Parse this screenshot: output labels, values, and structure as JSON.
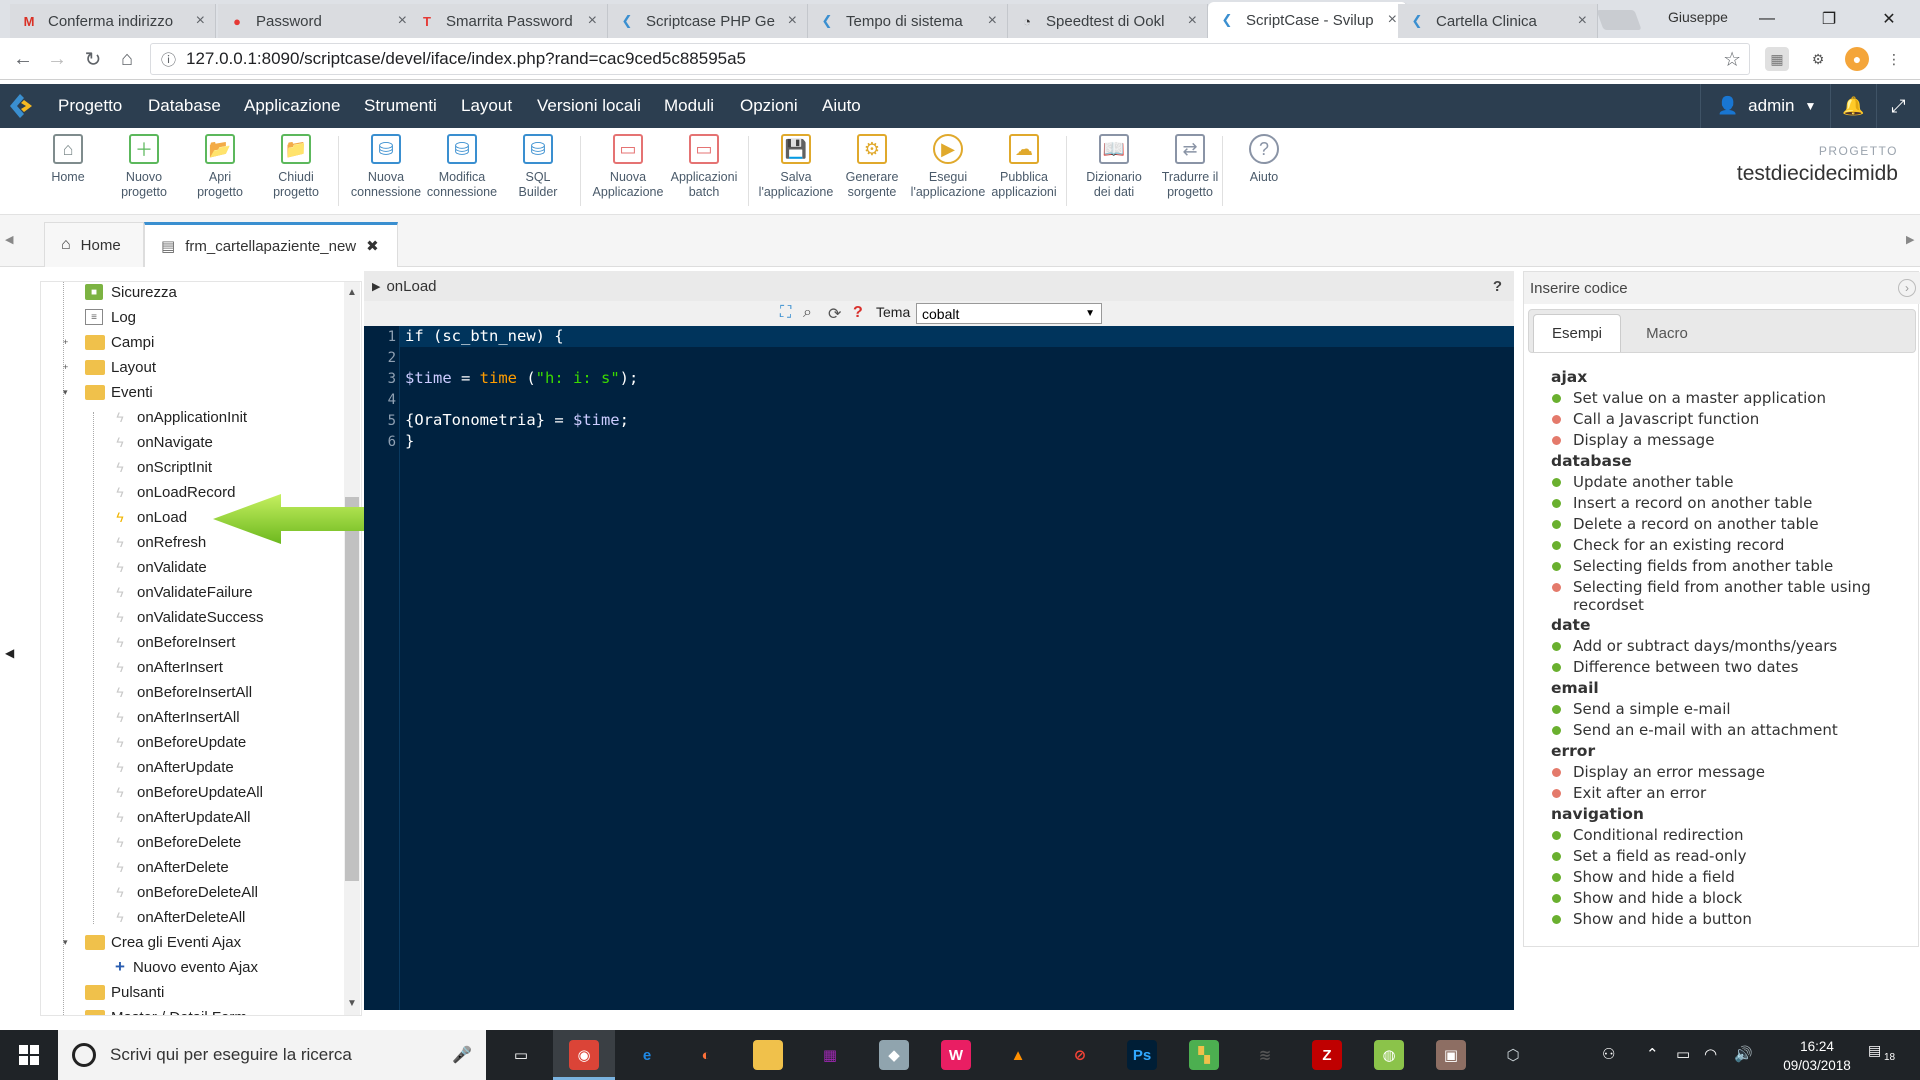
{
  "browser": {
    "tabs": [
      {
        "label": "Conferma indirizzo",
        "icon": "gmail-icon",
        "glyph": "M",
        "color": "#d93025"
      },
      {
        "label": "Password",
        "icon": "password-icon",
        "glyph": "●",
        "color": "#e53935"
      },
      {
        "label": "Smarrita Password",
        "icon": "t-logo-icon",
        "glyph": "T",
        "color": "#e53935"
      },
      {
        "label": "Scriptcase PHP Ge",
        "icon": "scriptcase-icon",
        "glyph": "❮",
        "color": "#3a8fd0"
      },
      {
        "label": "Tempo di sistema",
        "icon": "scriptcase-icon",
        "glyph": "❮",
        "color": "#3a8fd0"
      },
      {
        "label": "Speedtest di Ookl",
        "icon": "speedtest-icon",
        "glyph": "◔",
        "color": "#333333"
      },
      {
        "label": "ScriptCase - Svilup",
        "icon": "scriptcase-icon",
        "glyph": "❮",
        "color": "#3a8fd0"
      },
      {
        "label": "Cartella Clinica",
        "icon": "scriptcase-icon",
        "glyph": "❮",
        "color": "#3a8fd0"
      }
    ],
    "user": "Giuseppe",
    "url": "127.0.0.1:8090/scriptcase/devel/iface/index.php?rand=cac9ced5c88595a5"
  },
  "menu": {
    "items": [
      "Progetto",
      "Database",
      "Applicazione",
      "Strumenti",
      "Layout",
      "Versioni locali",
      "Moduli",
      "Opzioni",
      "Aiuto"
    ],
    "user": "admin"
  },
  "toolbar": {
    "buttons": [
      {
        "l1": "Home",
        "l2": "",
        "icon": "home-icon",
        "color": "#7f8c8d"
      },
      {
        "l1": "Nuovo",
        "l2": "progetto",
        "icon": "new-project-icon",
        "color": "#5cb85c"
      },
      {
        "l1": "Apri",
        "l2": "progetto",
        "icon": "open-folder-icon",
        "color": "#5cb85c"
      },
      {
        "l1": "Chiudi",
        "l2": "progetto",
        "icon": "close-folder-icon",
        "color": "#5cb85c"
      },
      {
        "l1": "Nuova",
        "l2": "connessione",
        "icon": "new-connection-icon",
        "color": "#3a8fd0"
      },
      {
        "l1": "Modifica",
        "l2": "connessione",
        "icon": "edit-connection-icon",
        "color": "#3a8fd0"
      },
      {
        "l1": "SQL",
        "l2": "Builder",
        "icon": "sql-builder-icon",
        "color": "#3a8fd0"
      },
      {
        "l1": "Nuova",
        "l2": "Applicazione",
        "icon": "new-app-icon",
        "color": "#e57373"
      },
      {
        "l1": "Applicazioni",
        "l2": "batch",
        "icon": "batch-apps-icon",
        "color": "#e57373"
      },
      {
        "l1": "Salva",
        "l2": "l'applicazione",
        "icon": "save-icon",
        "color": "#e0a92c"
      },
      {
        "l1": "Generare",
        "l2": "sorgente",
        "icon": "generate-source-icon",
        "color": "#e0a92c"
      },
      {
        "l1": "Esegui",
        "l2": "l'applicazione",
        "icon": "run-icon",
        "color": "#e0a92c"
      },
      {
        "l1": "Pubblica",
        "l2": "applicazioni",
        "icon": "publish-icon",
        "color": "#e0a92c"
      },
      {
        "l1": "Dizionario",
        "l2": "dei dati",
        "icon": "dictionary-icon",
        "color": "#8a94a6"
      },
      {
        "l1": "Tradurre il",
        "l2": "progetto",
        "icon": "translate-icon",
        "color": "#8a94a6"
      },
      {
        "l1": "Aiuto",
        "l2": "",
        "icon": "help-icon",
        "color": "#8a94a6"
      }
    ],
    "project_label": "PROGETTO",
    "project_name": "testdiecidecimidb"
  },
  "doctabs": {
    "home": "Home",
    "current": "frm_cartellapaziente_new"
  },
  "tree": {
    "top": [
      {
        "label": "Sicurezza",
        "kind": "lock"
      },
      {
        "label": "Log",
        "kind": "log"
      },
      {
        "label": "Campi",
        "kind": "folder"
      },
      {
        "label": "Layout",
        "kind": "folder"
      },
      {
        "label": "Eventi",
        "kind": "folder"
      }
    ],
    "events": [
      "onApplicationInit",
      "onNavigate",
      "onScriptInit",
      "onLoadRecord",
      "onLoad",
      "onRefresh",
      "onValidate",
      "onValidateFailure",
      "onValidateSuccess",
      "onBeforeInsert",
      "onAfterInsert",
      "onBeforeInsertAll",
      "onAfterInsertAll",
      "onBeforeUpdate",
      "onAfterUpdate",
      "onBeforeUpdateAll",
      "onAfterUpdateAll",
      "onBeforeDelete",
      "onAfterDelete",
      "onBeforeDeleteAll",
      "onAfterDeleteAll"
    ],
    "active_event": "onLoad",
    "ajax_folder": "Crea gli Eventi Ajax",
    "ajax_new": "Nuovo evento Ajax",
    "buttons_folder": "Pulsanti",
    "last_partial": "Master / Detail Form"
  },
  "editor": {
    "title": "onLoad",
    "help": "?",
    "theme_label": "Tema",
    "theme_value": "cobalt",
    "lines": [
      [
        {
          "t": "if (sc_btn_new) {",
          "c": ""
        }
      ],
      [
        {
          "t": "",
          "c": ""
        }
      ],
      [
        {
          "t": "$time",
          "c": "var"
        },
        {
          "t": " = ",
          "c": ""
        },
        {
          "t": "time",
          "c": "kw"
        },
        {
          "t": " (",
          "c": ""
        },
        {
          "t": "\"h: i: s\"",
          "c": "str"
        },
        {
          "t": ");",
          "c": ""
        }
      ],
      [
        {
          "t": "",
          "c": ""
        }
      ],
      [
        {
          "t": "{OraTonometria}",
          "c": ""
        },
        {
          "t": " = ",
          "c": ""
        },
        {
          "t": "$time",
          "c": "var"
        },
        {
          "t": ";",
          "c": ""
        }
      ],
      [
        {
          "t": "}",
          "c": ""
        }
      ]
    ]
  },
  "codepanel": {
    "title": "Inserire codice",
    "tabs": [
      "Esempi",
      "Macro"
    ],
    "groups": [
      {
        "name": "ajax",
        "items": [
          {
            "t": "Set value on a master application",
            "s": "g"
          },
          {
            "t": "Call a Javascript function",
            "s": "r"
          },
          {
            "t": "Display a message",
            "s": "r"
          }
        ]
      },
      {
        "name": "database",
        "items": [
          {
            "t": "Update another table",
            "s": "g"
          },
          {
            "t": "Insert a record on another table",
            "s": "g"
          },
          {
            "t": "Delete a record on another table",
            "s": "g"
          },
          {
            "t": "Check for an existing record",
            "s": "g"
          },
          {
            "t": "Selecting fields from another table",
            "s": "g"
          },
          {
            "t": "Selecting field from another table using recordset",
            "s": "r"
          }
        ]
      },
      {
        "name": "date",
        "items": [
          {
            "t": "Add or subtract days/months/years",
            "s": "g"
          },
          {
            "t": "Difference between two dates",
            "s": "g"
          }
        ]
      },
      {
        "name": "email",
        "items": [
          {
            "t": "Send a simple e-mail",
            "s": "g"
          },
          {
            "t": "Send an e-mail with an attachment",
            "s": "g"
          }
        ]
      },
      {
        "name": "error",
        "items": [
          {
            "t": "Display an error message",
            "s": "r"
          },
          {
            "t": "Exit after an error",
            "s": "r"
          }
        ]
      },
      {
        "name": "navigation",
        "items": [
          {
            "t": "Conditional redirection",
            "s": "g"
          },
          {
            "t": "Set a field as read-only",
            "s": "g"
          },
          {
            "t": "Show and hide a field",
            "s": "g"
          },
          {
            "t": "Show and hide a block",
            "s": "g"
          },
          {
            "t": "Show and hide a button",
            "s": "g"
          }
        ]
      }
    ]
  },
  "taskbar": {
    "search_placeholder": "Scrivi qui per eseguire la ricerca",
    "apps": [
      {
        "name": "task-view-icon",
        "glyph": "▭",
        "color": "#ffffff",
        "bg": "transparent"
      },
      {
        "name": "chrome-icon",
        "glyph": "◉",
        "color": "#ffffff",
        "bg": "#db4437"
      },
      {
        "name": "edge-icon",
        "glyph": "e",
        "color": "#1e88e5",
        "bg": "transparent"
      },
      {
        "name": "firefox-icon",
        "glyph": "◐",
        "color": "#ff7139",
        "bg": "transparent"
      },
      {
        "name": "explorer-icon",
        "glyph": "▬",
        "color": "#f0c14b",
        "bg": "#f0c14b"
      },
      {
        "name": "app-icon",
        "glyph": "▦",
        "color": "#9c27b0",
        "bg": "transparent"
      },
      {
        "name": "app2-icon",
        "glyph": "◆",
        "color": "#ffffff",
        "bg": "#90a4ae"
      },
      {
        "name": "app3-icon",
        "glyph": "W",
        "color": "#ffffff",
        "bg": "#e91e63"
      },
      {
        "name": "vlc-icon",
        "glyph": "▲",
        "color": "#ff8f00",
        "bg": "transparent"
      },
      {
        "name": "blocked-icon",
        "glyph": "⊘",
        "color": "#f44336",
        "bg": "transparent"
      },
      {
        "name": "photoshop-icon",
        "glyph": "Ps",
        "color": "#31a8ff",
        "bg": "#001e36"
      },
      {
        "name": "app4-icon",
        "glyph": "▚",
        "color": "#f0c14b",
        "bg": "#4caf50"
      },
      {
        "name": "app5-icon",
        "glyph": "≋",
        "color": "#555555",
        "bg": "transparent"
      },
      {
        "name": "filezilla-icon",
        "glyph": "Z",
        "color": "#ffffff",
        "bg": "#bf0000"
      },
      {
        "name": "android-icon",
        "glyph": "◍",
        "color": "#ffffff",
        "bg": "#8bc34a"
      },
      {
        "name": "app6-icon",
        "glyph": "▣",
        "color": "#ffffff",
        "bg": "#8d6e63"
      },
      {
        "name": "app7-icon",
        "glyph": "⬡",
        "color": "#cfd8dc",
        "bg": "transparent"
      }
    ],
    "time": "16:24",
    "date": "09/03/2018",
    "notif_count": "18"
  }
}
